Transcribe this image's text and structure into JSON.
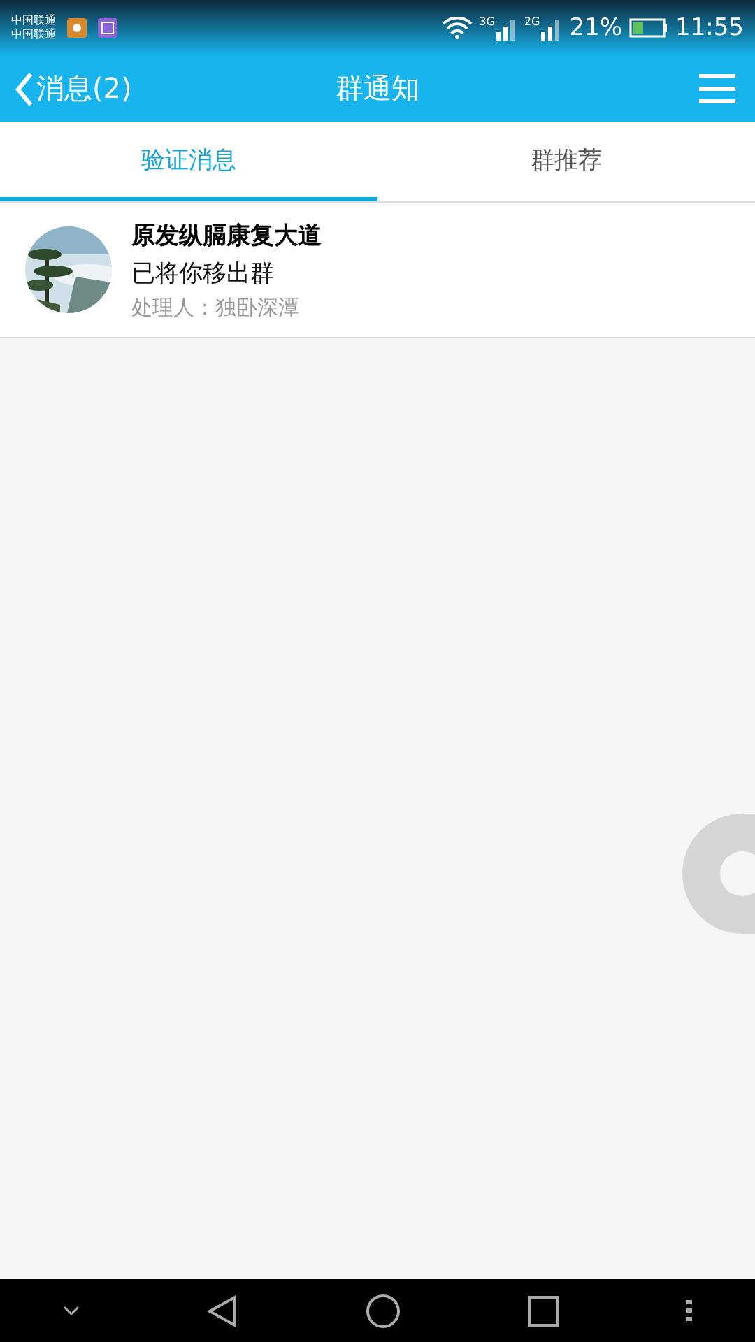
{
  "status_bar": {
    "carriers": [
      "中国联通",
      "中国联通"
    ],
    "networks": [
      "3G",
      "2G"
    ],
    "battery": "21%",
    "time": "11:55"
  },
  "header": {
    "back": "消息(2)",
    "title": "群通知"
  },
  "tabs": [
    {
      "label": "验证消息",
      "selected": true
    },
    {
      "label": "群推荐",
      "selected": false
    }
  ],
  "notices": [
    {
      "kind": "picture",
      "group": "原发纵膈康复大道",
      "message": "已将你移出群",
      "handler": "处理人：独卧深潭"
    }
  ]
}
